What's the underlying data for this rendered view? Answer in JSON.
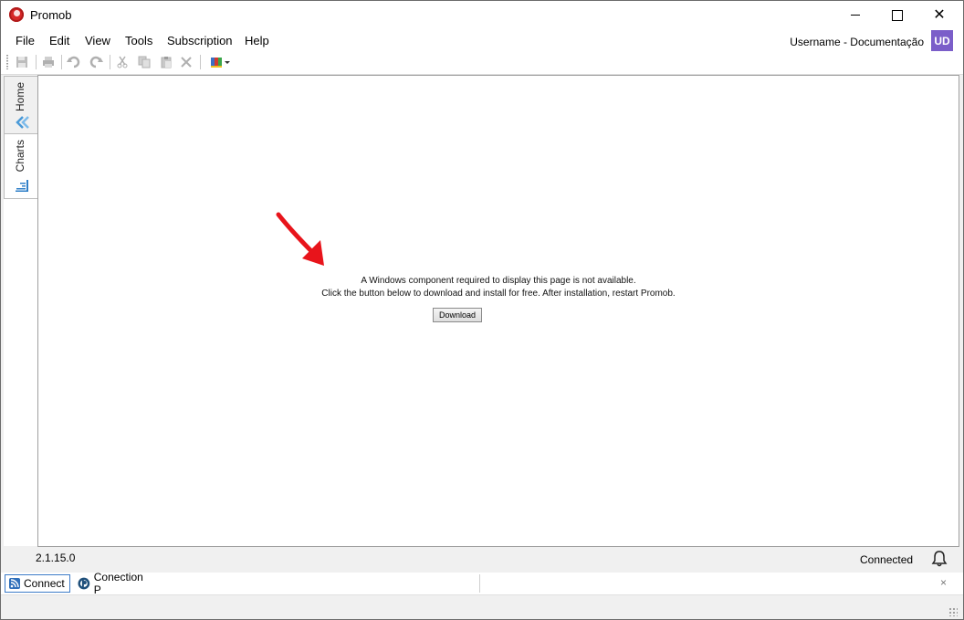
{
  "window": {
    "title": "Promob",
    "controls": {
      "minimize_icon": "minimize-icon",
      "maximize_icon": "maximize-icon",
      "close_glyph": "✕"
    }
  },
  "menu": {
    "items": [
      "File",
      "Edit",
      "View",
      "Tools",
      "Subscription",
      "Help"
    ],
    "user": "Username - Documentação",
    "avatar_initials": "UD",
    "avatar_color": "#7b5ec9"
  },
  "toolbar": {
    "icons": [
      "save-icon",
      "print-icon",
      "undo-icon",
      "redo-icon",
      "cut-icon",
      "copy-icon",
      "paste-icon",
      "delete-icon",
      "theme-color-icon"
    ]
  },
  "sidetabs": [
    {
      "label": "Home",
      "icon": "home-chevrons-icon"
    },
    {
      "label": "Charts",
      "icon": "charts-icon"
    }
  ],
  "content": {
    "message_line1": "A Windows component required to display this page is not available.",
    "message_line2": "Click the button below to download and install for free. After installation, restart Promob.",
    "download_label": "Download",
    "arrow_color": "#e8141b"
  },
  "status": {
    "version": "2.1.15.0",
    "connection": "Connected"
  },
  "bottom_tabs": [
    {
      "label": "Connect",
      "icon": "rss-icon"
    },
    {
      "label": "Conection P",
      "icon": "promob-logo-icon"
    }
  ],
  "panel_close_glyph": "×"
}
